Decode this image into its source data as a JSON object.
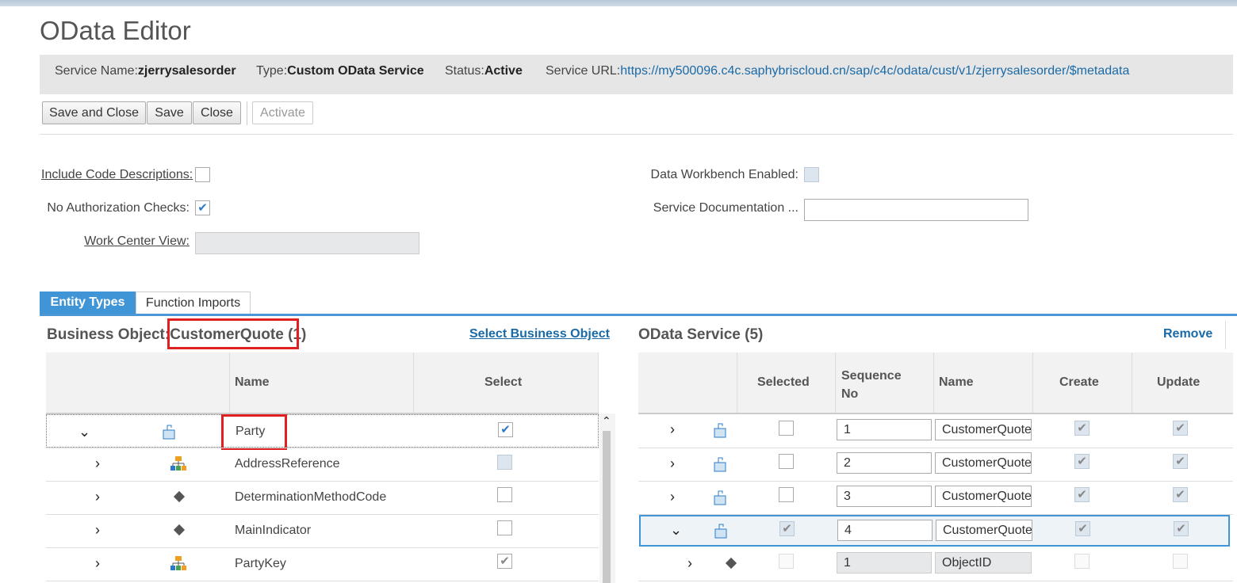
{
  "page": {
    "title": "OData Editor"
  },
  "info": {
    "service_name_label": "Service Name:",
    "service_name": "zjerrysalesorder",
    "type_label": "Type:",
    "type": "Custom OData Service",
    "status_label": "Status:",
    "status": "Active",
    "url_label": "Service URL:",
    "url": "https://my500096.c4c.saphybriscloud.cn/sap/c4c/odata/cust/v1/zjerrysalesorder/$metadata"
  },
  "toolbar": {
    "save_close": "Save and Close",
    "save": "Save",
    "close": "Close",
    "activate": "Activate"
  },
  "form": {
    "include_code_desc": "Include Code Descriptions:",
    "include_code_desc_checked": false,
    "no_auth_checks": "No Authorization Checks:",
    "no_auth_checks_checked": true,
    "work_center_view": "Work Center View:",
    "work_center_view_value": "",
    "data_workbench": "Data Workbench Enabled:",
    "data_workbench_checked": false,
    "service_doc": "Service Documentation ...",
    "service_doc_value": ""
  },
  "tabs": [
    {
      "label": "Entity Types",
      "active": true
    },
    {
      "label": "Function Imports",
      "active": false
    }
  ],
  "left_panel": {
    "title_prefix": "Business Object:",
    "title_name": "CustomerQuote",
    "title_suffix": " (1)",
    "select_link": "Select Business Object",
    "columns": [
      "Name",
      "Select"
    ],
    "rows": [
      {
        "expand": "v",
        "icon": "node-icon",
        "name": "Party",
        "select": "checked"
      },
      {
        "expand": ">",
        "icon": "hierarchy-icon",
        "name": "AddressReference",
        "select": "disabled"
      },
      {
        "expand": ">",
        "icon": "diamond-icon",
        "name": "DeterminationMethodCode",
        "select": "unchecked"
      },
      {
        "expand": ">",
        "icon": "diamond-icon",
        "name": "MainIndicator",
        "select": "unchecked"
      },
      {
        "expand": ">",
        "icon": "hierarchy-icon",
        "name": "PartyKey",
        "select": "gray-checked"
      }
    ]
  },
  "right_panel": {
    "title": "OData Service (5)",
    "remove_link": "Remove",
    "columns": [
      "Selected",
      "Sequence No",
      "Name",
      "Create",
      "Update"
    ],
    "rows": [
      {
        "expand": ">",
        "seq": "1",
        "name": "CustomerQuote"
      },
      {
        "expand": ">",
        "seq": "2",
        "name": "CustomerQuote"
      },
      {
        "expand": ">",
        "seq": "3",
        "name": "CustomerQuote"
      },
      {
        "expand": "v",
        "seq": "4",
        "name": "CustomerQuote"
      },
      {
        "expand": ">",
        "seq": "1",
        "name": "ObjectID"
      }
    ]
  },
  "colors": {
    "accent": "#3f95d6",
    "link": "#1a6aa8",
    "highlight": "#e02020"
  }
}
